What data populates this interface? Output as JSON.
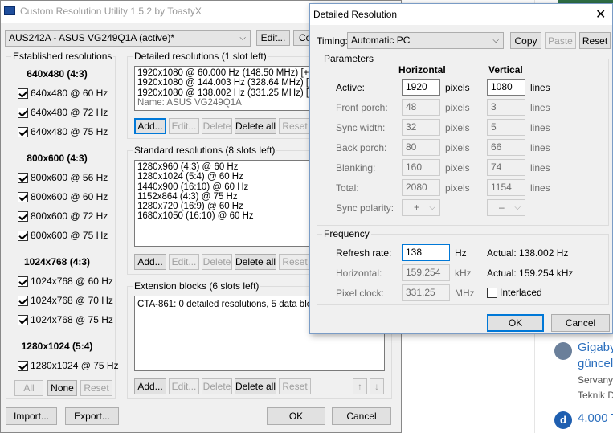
{
  "main": {
    "title": "Custom Resolution Utility 1.5.2 by ToastyX",
    "monitor": "AUS242A - ASUS VG249Q1A (active)*",
    "edit_label": "Edit...",
    "copy_label": "Copy",
    "established": {
      "title": "Established resolutions",
      "groups": [
        {
          "header": "640x480 (4:3)",
          "items": [
            "640x480 @ 60 Hz",
            "640x480 @ 72 Hz",
            "640x480 @ 75 Hz"
          ]
        },
        {
          "header": "800x600 (4:3)",
          "items": [
            "800x600 @ 56 Hz",
            "800x600 @ 60 Hz",
            "800x600 @ 72 Hz",
            "800x600 @ 75 Hz"
          ]
        },
        {
          "header": "1024x768 (4:3)",
          "items": [
            "1024x768 @ 60 Hz",
            "1024x768 @ 70 Hz",
            "1024x768 @ 75 Hz"
          ]
        },
        {
          "header": "1280x1024 (5:4)",
          "items": [
            "1280x1024 @ 75 Hz"
          ]
        }
      ],
      "all": "All",
      "none": "None",
      "reset": "Reset"
    },
    "detailed": {
      "title": "Detailed resolutions (1 slot left)",
      "rows": [
        "1920x1080 @ 60.000 Hz (148.50 MHz) [+/+]",
        "1920x1080 @ 144.003 Hz (328.64 MHz) [+/-]",
        "1920x1080 @ 138.002 Hz (331.25 MHz) [+/-]"
      ],
      "name": "Name: ASUS VG249Q1A"
    },
    "standard": {
      "title": "Standard resolutions (8 slots left)",
      "rows": [
        "1280x960 (4:3) @ 60 Hz",
        "1280x1024 (5:4) @ 60 Hz",
        "1440x900 (16:10) @ 60 Hz",
        "1152x864 (4:3) @ 75 Hz",
        "1280x720 (16:9) @ 60 Hz",
        "1680x1050 (16:10) @ 60 Hz"
      ]
    },
    "extension": {
      "title": "Extension blocks (6 slots left)",
      "rows": [
        "CTA-861: 0 detailed resolutions, 5 data blocks"
      ]
    },
    "buttons": {
      "add": "Add...",
      "edit": "Edit...",
      "delete": "Delete",
      "delete_all": "Delete all",
      "reset": "Reset"
    },
    "import": "Import...",
    "export": "Export...",
    "ok": "OK",
    "cancel": "Cancel"
  },
  "dialog": {
    "title": "Detailed Resolution",
    "timing_label": "Timing:",
    "timing_value": "Automatic PC",
    "copy": "Copy",
    "paste": "Paste",
    "reset": "Reset",
    "params_title": "Parameters",
    "col_h": "Horizontal",
    "col_v": "Vertical",
    "rows": [
      {
        "label": "Active:",
        "h": "1920",
        "hu": "pixels",
        "v": "1080",
        "vu": "lines"
      },
      {
        "label": "Front porch:",
        "h": "48",
        "hu": "pixels",
        "v": "3",
        "vu": "lines"
      },
      {
        "label": "Sync width:",
        "h": "32",
        "hu": "pixels",
        "v": "5",
        "vu": "lines"
      },
      {
        "label": "Back porch:",
        "h": "80",
        "hu": "pixels",
        "v": "66",
        "vu": "lines"
      },
      {
        "label": "Blanking:",
        "h": "160",
        "hu": "pixels",
        "v": "74",
        "vu": "lines"
      },
      {
        "label": "Total:",
        "h": "2080",
        "hu": "pixels",
        "v": "1154",
        "vu": "lines"
      }
    ],
    "sync_polarity_label": "Sync polarity:",
    "sync_h": "+",
    "sync_v": "–",
    "freq_title": "Frequency",
    "refresh_label": "Refresh rate:",
    "refresh_value": "138",
    "refresh_unit": "Hz",
    "actual_refresh": "Actual: 138.002 Hz",
    "horizontal_label": "Horizontal:",
    "horizontal_value": "159.254",
    "horizontal_unit": "kHz",
    "actual_horizontal": "Actual: 159.254 kHz",
    "pixel_clock_label": "Pixel clock:",
    "pixel_clock_value": "331.25",
    "pixel_clock_unit": "MHz",
    "interlaced": "Interlaced",
    "ok": "OK",
    "cancel": "Cancel"
  },
  "background": {
    "items": [
      {
        "avatar": "",
        "title1": "Gigaby",
        "title2": "güncel",
        "meta1": "Servany",
        "meta2": "Teknik D"
      },
      {
        "avatar": "d",
        "title1": "4.000 T",
        "title2": "",
        "meta1": "",
        "meta2": ""
      }
    ]
  }
}
